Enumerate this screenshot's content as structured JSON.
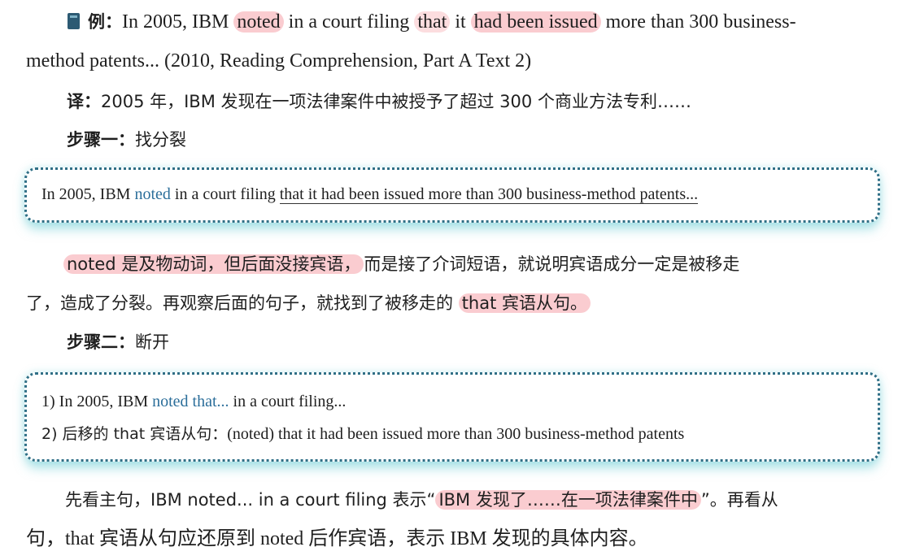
{
  "example": {
    "label": "例：",
    "p1": "In 2005, IBM ",
    "w_noted": "noted",
    "p2": " in a court filing ",
    "w_that": "that",
    "p3": " it ",
    "w_issued": "had been issued",
    "p4": " more than 300 business-",
    "line2": "method patents... (2010, Reading Comprehension, Part A Text 2)"
  },
  "translation": {
    "label": "译：",
    "text": "2005 年，IBM 发现在一项法律案件中被授予了超过 300 个商业方法专利……"
  },
  "step1": {
    "label": "步骤一：",
    "text": "找分裂"
  },
  "box1": {
    "p1": "In 2005, IBM ",
    "noted": "noted",
    "p2": " in a court filing ",
    "underlined": "that it had been issued more than 300 business-method patents..."
  },
  "explain1": {
    "hl": "noted 是及物动词，但后面没接宾语，",
    "rest1": "而是接了介词短语，就说明宾语成分一定是被移走",
    "line2a": "了，造成了分裂。再观察后面的句子，就找到了被移走的 ",
    "hl2": "that 宾语从句。"
  },
  "step2": {
    "label": "步骤二：",
    "text": "断开"
  },
  "box2": {
    "r1a": "1) In 2005, IBM ",
    "r1b": "noted that...",
    "r1c": " in a court filing...",
    "r2a": "2) 后移的 that 宾语从句：",
    "r2b": "(noted) that it had been issued more than 300 business-method patents"
  },
  "summary": {
    "a": "先看主句，IBM noted... in a court filing 表示“",
    "hl": "IBM 发现了……在一项法律案件中",
    "b": "”。再看从",
    "line2": "句，that 宾语从句应还原到 noted 后作宾语，表示 IBM 发现的具体内容。"
  }
}
